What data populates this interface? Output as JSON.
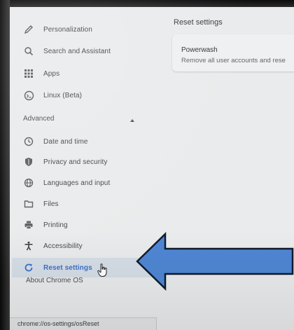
{
  "sidebar": {
    "items": [
      {
        "label": "Personalization",
        "icon": "pencil-icon"
      },
      {
        "label": "Search and Assistant",
        "icon": "search-icon"
      },
      {
        "label": "Apps",
        "icon": "apps-grid-icon"
      },
      {
        "label": "Linux (Beta)",
        "icon": "terminal-icon"
      }
    ],
    "advanced_label": "Advanced",
    "advanced_items": [
      {
        "label": "Date and time",
        "icon": "clock-icon"
      },
      {
        "label": "Privacy and security",
        "icon": "shield-icon"
      },
      {
        "label": "Languages and input",
        "icon": "globe-icon"
      },
      {
        "label": "Files",
        "icon": "folder-icon"
      },
      {
        "label": "Printing",
        "icon": "printer-icon"
      },
      {
        "label": "Accessibility",
        "icon": "accessibility-icon"
      },
      {
        "label": "Reset settings",
        "icon": "reset-icon",
        "active": true
      }
    ],
    "about_label": "About Chrome OS"
  },
  "main": {
    "title": "Reset settings",
    "powerwash": {
      "title": "Powerwash",
      "description": "Remove all user accounts and rese"
    }
  },
  "status_bar": {
    "url": "chrome://os-settings/osReset"
  },
  "colors": {
    "accent": "#3b70c7",
    "arrow_fill": "#4f86d3",
    "active_bg": "#d5dde6"
  }
}
